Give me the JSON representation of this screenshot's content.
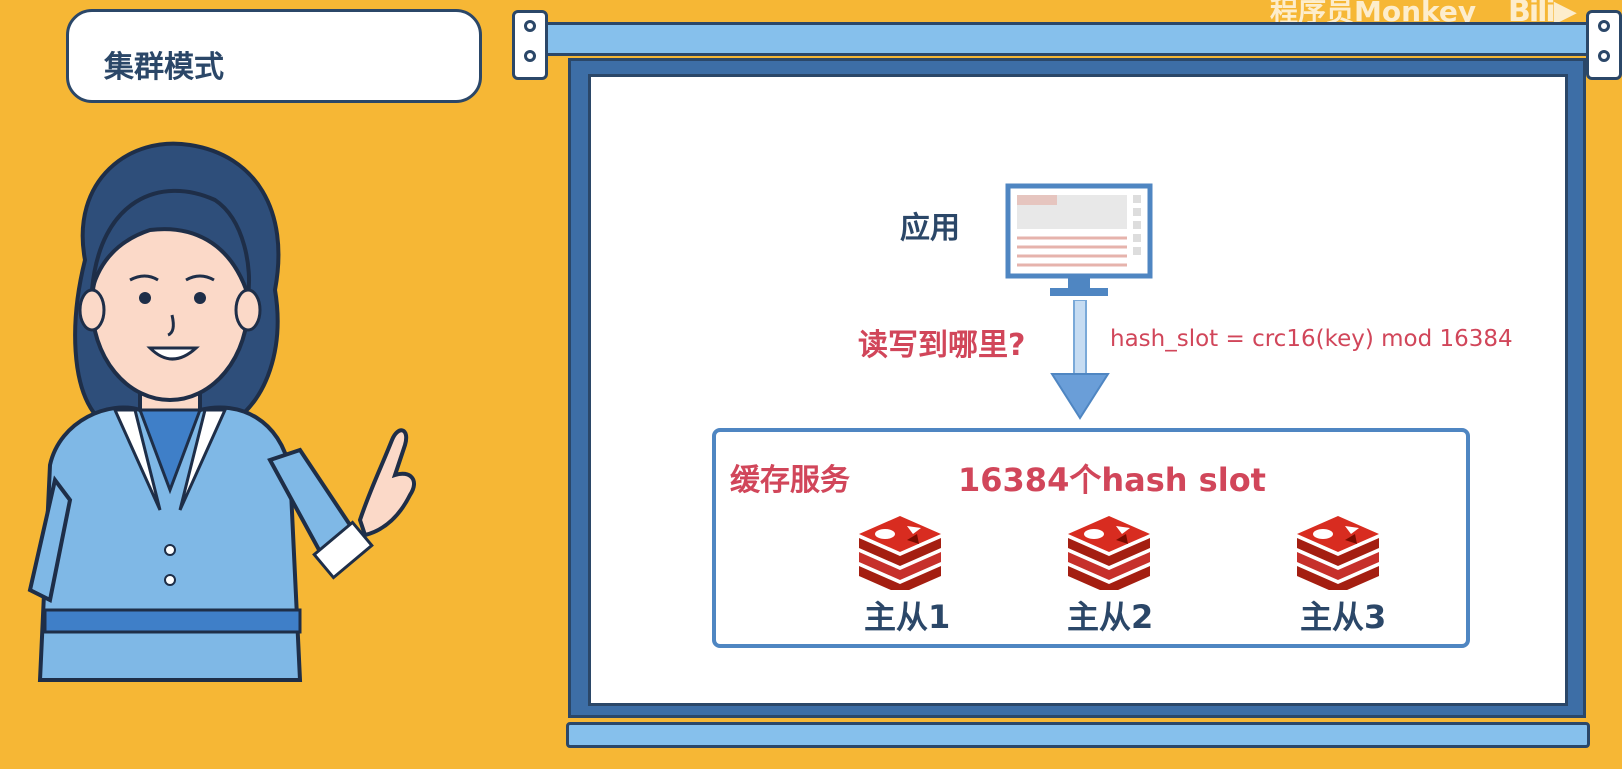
{
  "watermark": {
    "text": "程序员Monkey",
    "logo": "bilibili"
  },
  "title_card": {
    "title": "集群模式"
  },
  "diagram": {
    "app_label": "应用",
    "question": "读写到哪里?",
    "formula": "hash_slot = crc16(key) mod 16384",
    "cache_title": "缓存服务",
    "slot_info": "16384个hash slot",
    "nodes": [
      {
        "label": "主从1",
        "icon": "redis-icon"
      },
      {
        "label": "主从2",
        "icon": "redis-icon"
      },
      {
        "label": "主从3",
        "icon": "redis-icon"
      }
    ]
  },
  "colors": {
    "background": "#F6B735",
    "accent_red": "#D1465A",
    "navy": "#2B4768",
    "rail_blue": "#86C0EC"
  }
}
